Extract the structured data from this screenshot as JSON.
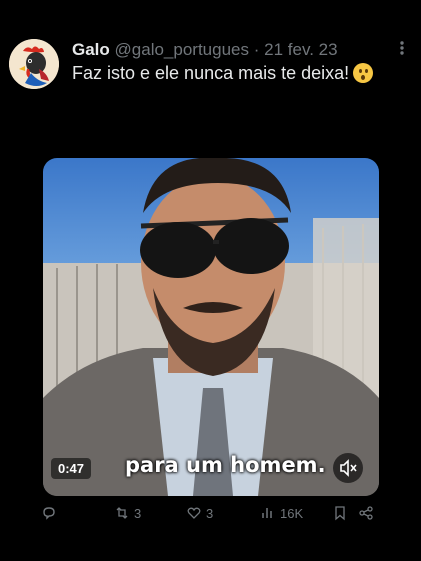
{
  "tweet": {
    "author_name": "Galo",
    "handle": "@galo_portugues",
    "separator": "·",
    "date": "21 fev. 23",
    "text": "Faz isto e ele nunca mais te deixa!",
    "emoji_icon": "hushed-face-emoji-icon"
  },
  "video": {
    "duration": "0:47",
    "caption": "para um homem.",
    "muted": true
  },
  "actions": {
    "replies": "",
    "retweets": "3",
    "likes": "3",
    "views": "16K"
  },
  "colors": {
    "background": "#000000",
    "text": "#e7e9ea",
    "muted": "#71767b"
  }
}
